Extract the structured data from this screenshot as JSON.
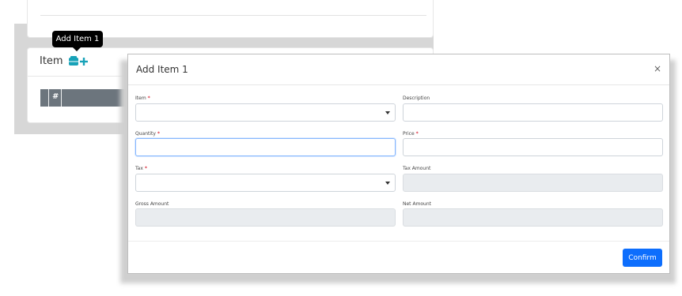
{
  "page": {
    "card_title": "Item",
    "add_icon": "add-item-icon",
    "table_header": [
      "#"
    ]
  },
  "tooltip": {
    "text": "Add Item 1"
  },
  "modal": {
    "title": "Add Item 1",
    "close_label": "×",
    "fields": {
      "item": {
        "label": "Item",
        "required": "*",
        "value": ""
      },
      "description": {
        "label": "Description",
        "value": ""
      },
      "quantity": {
        "label": "Quantity",
        "required": "*",
        "value": ""
      },
      "price": {
        "label": "Price",
        "required": "*",
        "value": ""
      },
      "tax": {
        "label": "Tax",
        "required": "*",
        "value": ""
      },
      "tax_amount": {
        "label": "Tax Amount",
        "value": ""
      },
      "gross_amount": {
        "label": "Gross Amount",
        "value": ""
      },
      "net_amount": {
        "label": "Net Amount",
        "value": ""
      }
    },
    "confirm_label": "Confirm"
  },
  "colors": {
    "accent": "#0d6efd",
    "add_icon": "#17a2b8",
    "table_header_bg": "#6c757d",
    "required": "#dc3545",
    "tooltip_bg": "#000000"
  }
}
